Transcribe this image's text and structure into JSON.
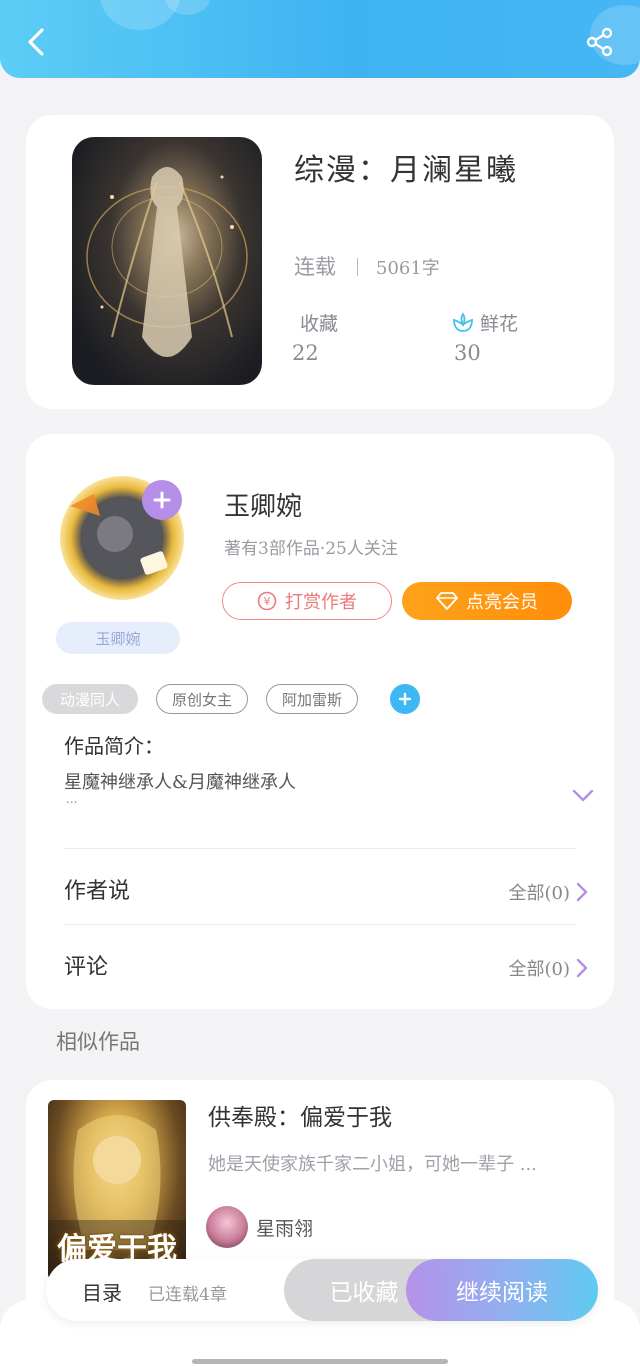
{
  "header": {
    "back_icon": "chevron-left-icon",
    "share_icon": "share-icon"
  },
  "book": {
    "title": "综漫：月澜星曦",
    "status": "连载",
    "word_count": "5061字",
    "favorites_label": "收藏",
    "favorites_value": "22",
    "flowers_label": "鲜花",
    "flowers_value": "30"
  },
  "author": {
    "name": "玉卿婉",
    "meta": "著有3部作品·25人关注",
    "badge": "玉卿婉",
    "reward_label": "打赏作者",
    "vip_label": "点亮会员"
  },
  "tags": [
    "动漫同人",
    "原创女主",
    "阿加雷斯"
  ],
  "intro": {
    "label": "作品简介：",
    "text": "星魔神继承人&月魔神继承人",
    "ellipsis": "..."
  },
  "author_says": {
    "label": "作者说",
    "right": "全部(0)"
  },
  "comments": {
    "label": "评论",
    "right": "全部(0)"
  },
  "similar": {
    "heading": "相似作品",
    "items": [
      {
        "title": "供奉殿：偏爱于我",
        "desc": "她是天使家族千家二小姐，可她一辈子 ...",
        "author": "星雨翎",
        "cover_text": "偏爱于我"
      }
    ]
  },
  "bottom": {
    "toc_label": "目录",
    "chapters": "已连载4章",
    "collected_label": "已收藏",
    "continue_label": "继续阅读"
  },
  "colors": {
    "accent": "#46b6f4",
    "purple": "#b58ee8",
    "orange": "#ff9a14"
  }
}
